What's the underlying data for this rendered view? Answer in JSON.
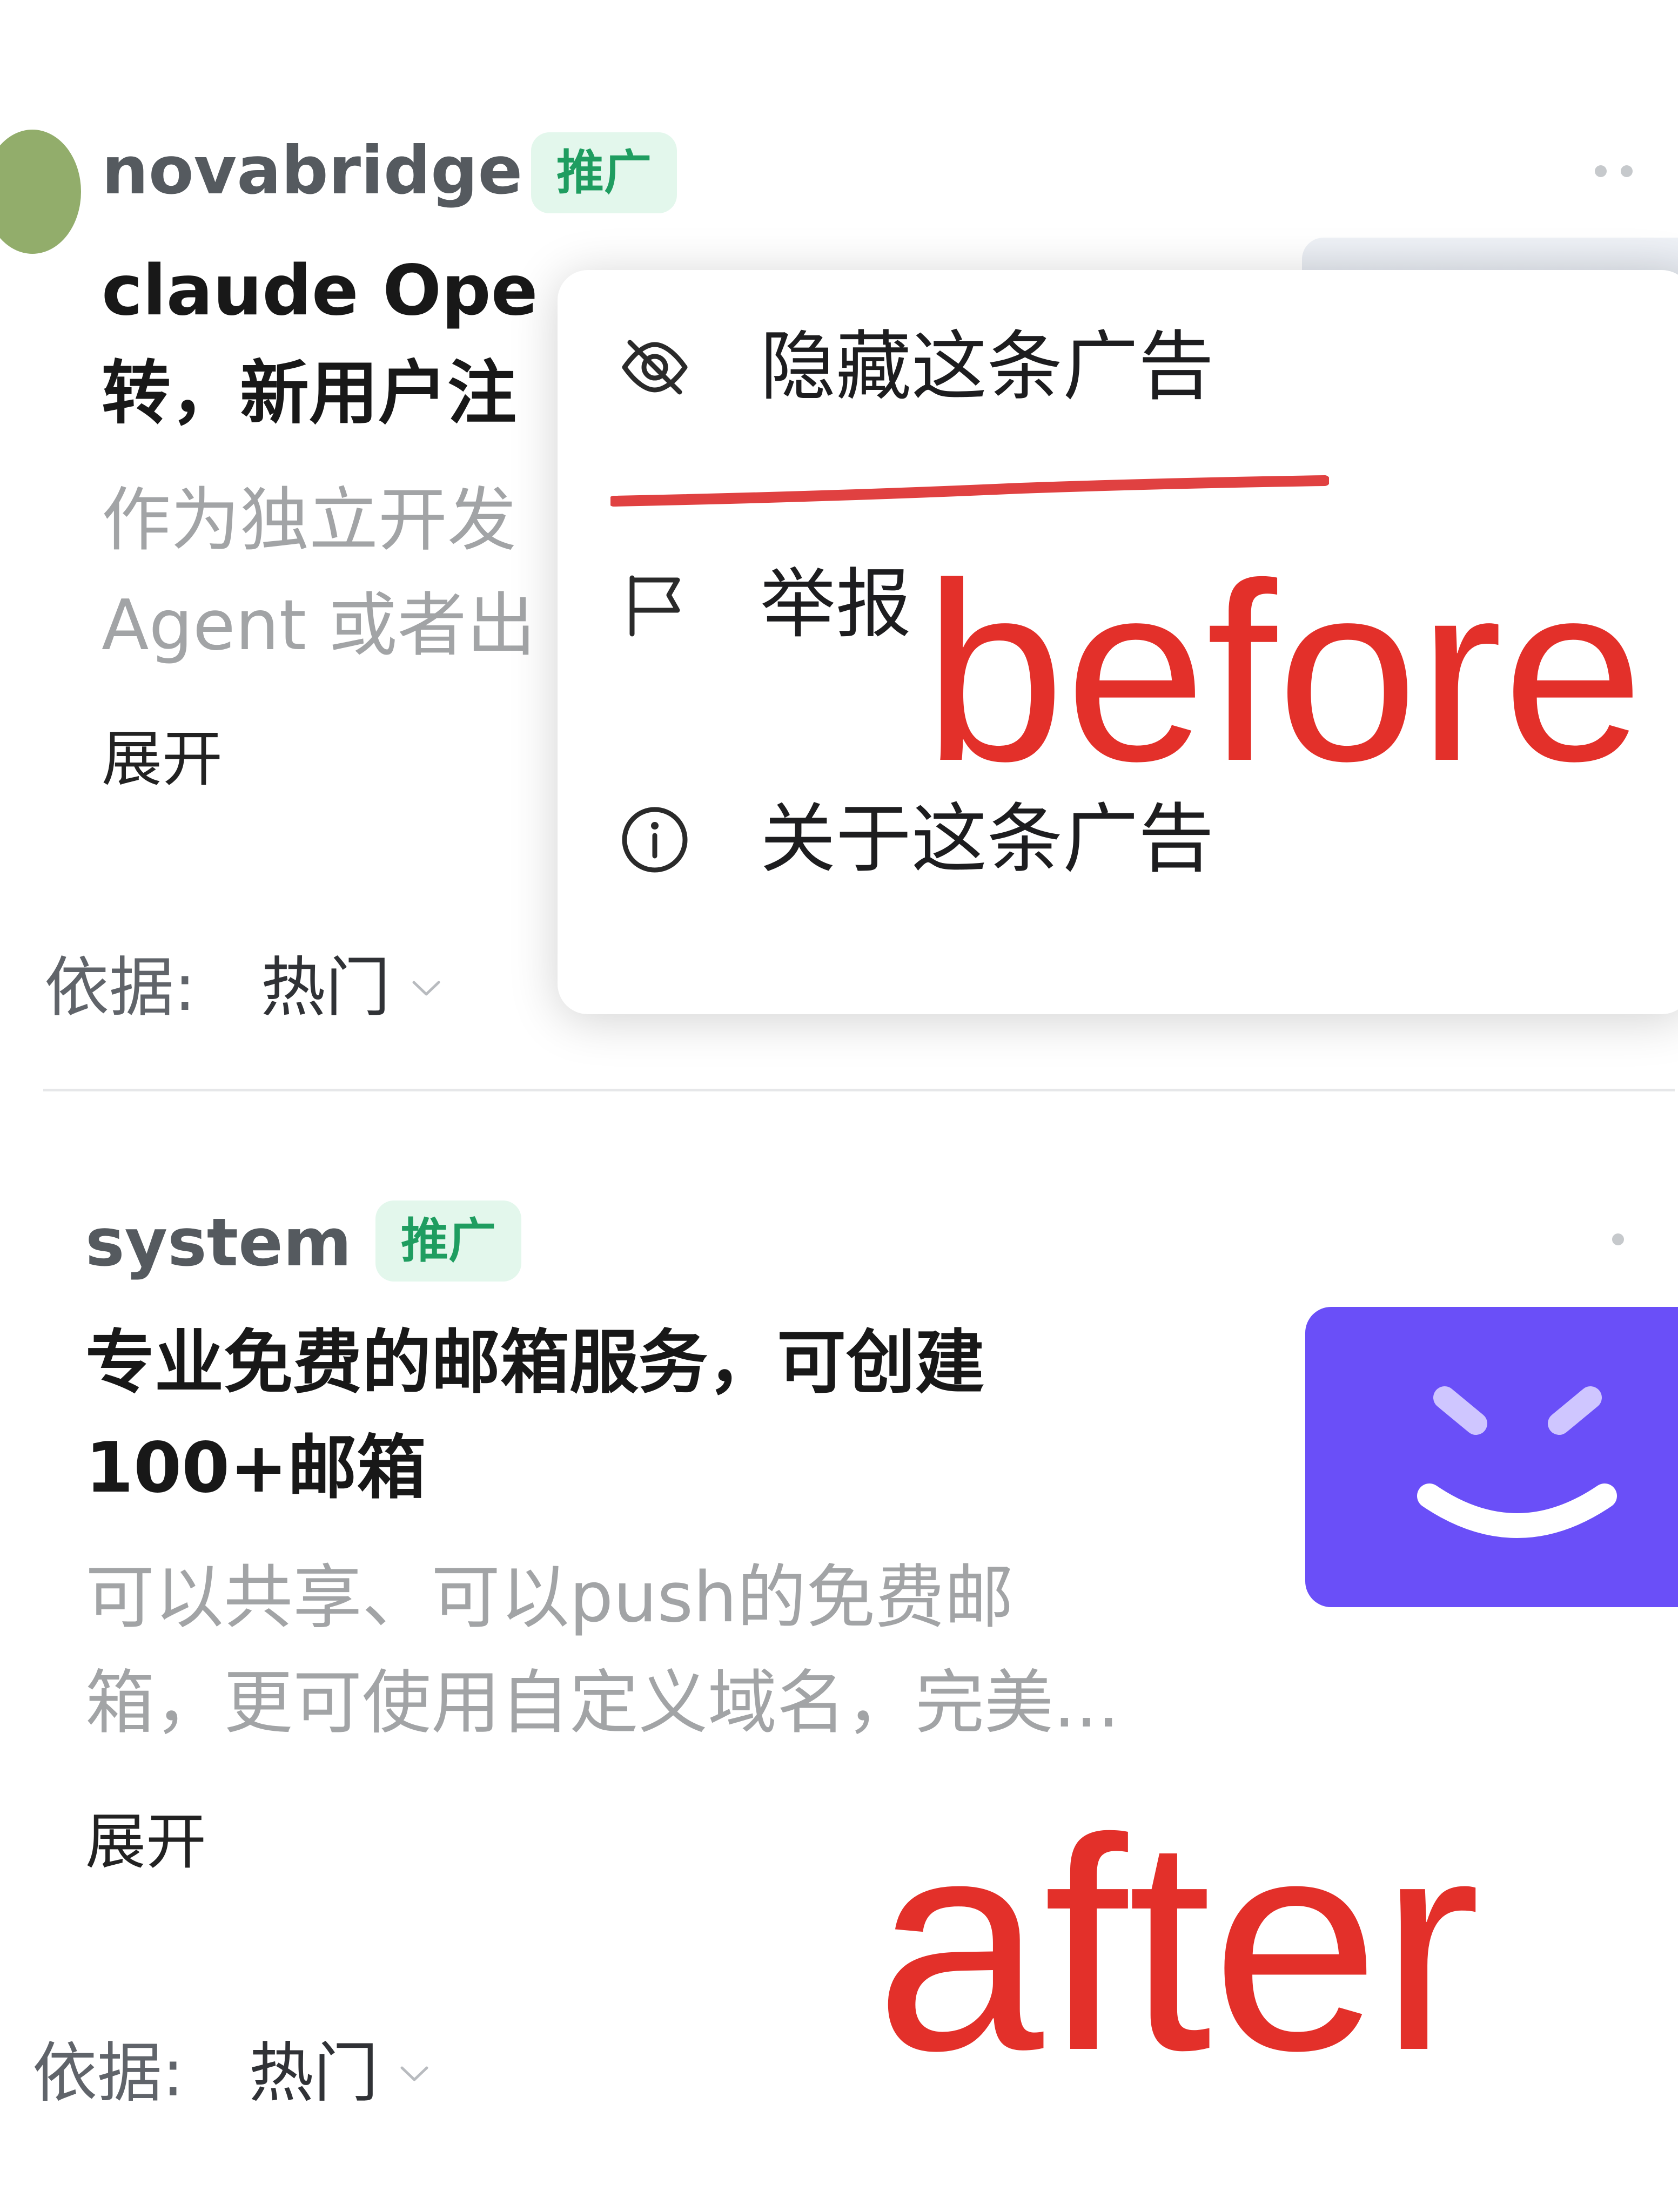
{
  "cards": [
    {
      "author": "novabridge",
      "badge": "推广",
      "title_line1": "claude Ope",
      "title_line2": "转，新用户注",
      "desc_line1": "作为独立开发",
      "desc_line2": "Agent 或者出",
      "expand": "展开",
      "basis_label": "依据:",
      "basis_value": "热门"
    },
    {
      "author": "system",
      "badge": "推广",
      "title_line1": "专业免费的邮箱服务，可创建",
      "title_line2": "100+邮箱",
      "desc_line1": "可以共享、可以push的免费邮",
      "desc_line2": "箱，更可使用自定义域名，完美...",
      "expand": "展开",
      "basis_label": "依据:",
      "basis_value": "热门"
    }
  ],
  "menu": {
    "items": [
      {
        "label": "隐藏这条广告",
        "icon": "eye-off-icon"
      },
      {
        "label": "举报",
        "icon": "flag-icon"
      },
      {
        "label": "关于这条广告",
        "icon": "info-icon"
      }
    ]
  },
  "annotations": {
    "before": "before",
    "after": "after",
    "color": "#e3302a"
  },
  "colors": {
    "badge_bg": "#e3f7ec",
    "badge_text": "#1f9d60",
    "thumbnail_purple": "#6a4ff8",
    "avatar_green": "#92ad6b"
  }
}
